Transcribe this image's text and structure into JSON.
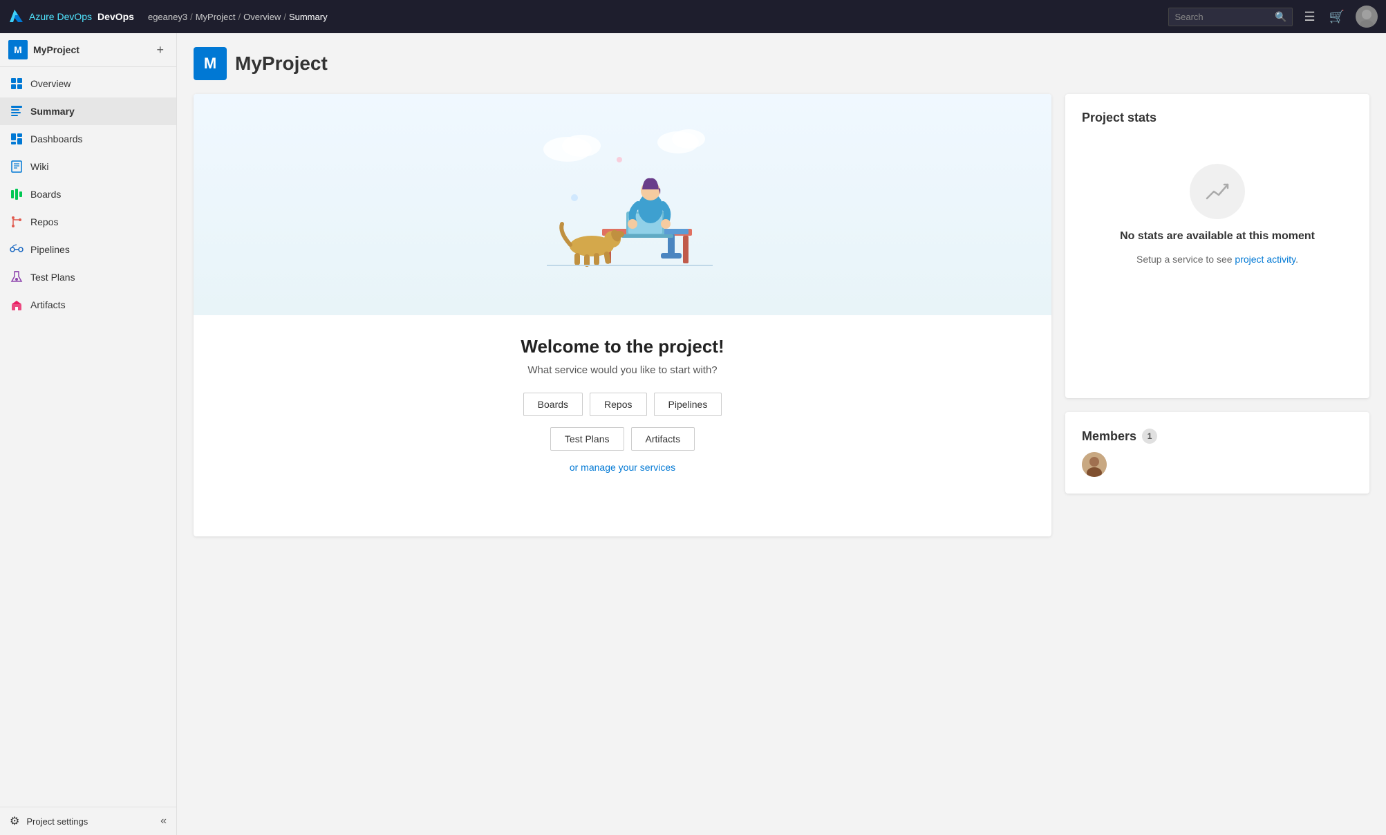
{
  "topNav": {
    "appName": "Azure DevOps",
    "breadcrumbs": [
      {
        "label": "egeaney3",
        "link": true
      },
      {
        "label": "MyProject",
        "link": true
      },
      {
        "label": "Overview",
        "link": true
      },
      {
        "label": "Summary",
        "link": false
      }
    ],
    "search": {
      "placeholder": "Search",
      "value": ""
    }
  },
  "sidebar": {
    "projectName": "MyProject",
    "projectInitial": "M",
    "items": [
      {
        "id": "overview",
        "label": "Overview",
        "active": false,
        "icon": "overview"
      },
      {
        "id": "summary",
        "label": "Summary",
        "active": true,
        "icon": "summary"
      },
      {
        "id": "dashboards",
        "label": "Dashboards",
        "active": false,
        "icon": "dashboards"
      },
      {
        "id": "wiki",
        "label": "Wiki",
        "active": false,
        "icon": "wiki"
      },
      {
        "id": "boards",
        "label": "Boards",
        "active": false,
        "icon": "boards"
      },
      {
        "id": "repos",
        "label": "Repos",
        "active": false,
        "icon": "repos"
      },
      {
        "id": "pipelines",
        "label": "Pipelines",
        "active": false,
        "icon": "pipelines"
      },
      {
        "id": "testplans",
        "label": "Test Plans",
        "active": false,
        "icon": "testplans"
      },
      {
        "id": "artifacts",
        "label": "Artifacts",
        "active": false,
        "icon": "artifacts"
      }
    ],
    "footer": {
      "label": "Project settings"
    }
  },
  "page": {
    "projectInitial": "M",
    "projectName": "MyProject"
  },
  "welcome": {
    "title": "Welcome to the project!",
    "subtitle": "What service would you like to start with?",
    "services": [
      "Boards",
      "Repos",
      "Pipelines",
      "Test Plans",
      "Artifacts"
    ],
    "manageLink": "or manage your services"
  },
  "projectStats": {
    "title": "Project stats",
    "emptyMessage": "No stats are available at this moment",
    "emptySubtitle": "Setup a service to see",
    "linkText": "project activity",
    "afterLink": "."
  },
  "members": {
    "title": "Members",
    "count": "1"
  }
}
